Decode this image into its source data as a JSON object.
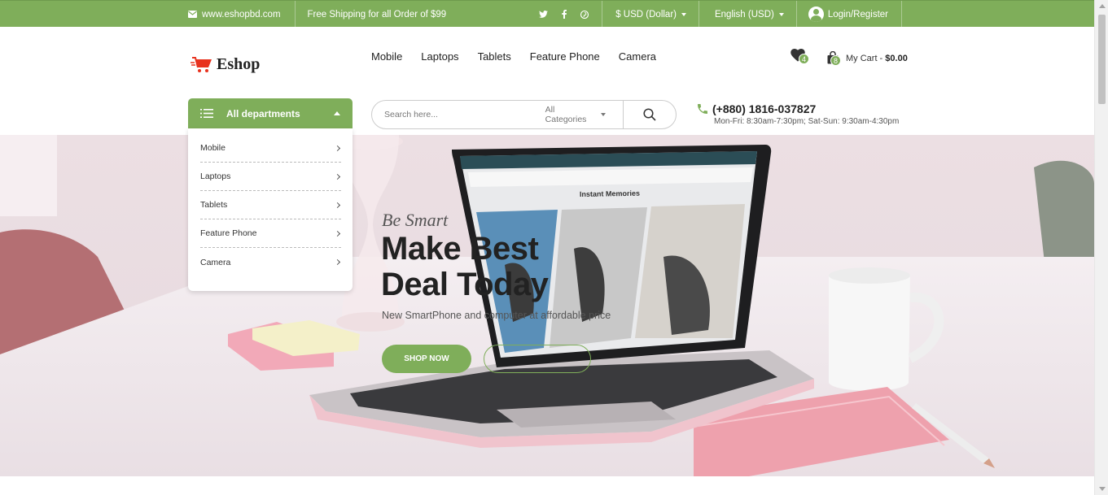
{
  "topbar": {
    "email": "www.eshopbd.com",
    "shipping": "Free Shipping for all Order of $99",
    "social": [
      "twitter-icon",
      "facebook-icon",
      "pinterest-icon"
    ],
    "currency": "$ USD (Dollar)",
    "language": "English (USD)",
    "login": "Login/Register"
  },
  "header": {
    "logo": "Eshop",
    "nav": [
      "Mobile",
      "Laptops",
      "Tablets",
      "Feature Phone",
      "Camera"
    ],
    "wishlist_count": "4",
    "cart_count": "8",
    "cart_label": "My Cart - ",
    "cart_amount": "$0.00"
  },
  "departments": {
    "title": "All departments",
    "items": [
      "Mobile",
      "Laptops",
      "Tablets",
      "Feature Phone",
      "Camera"
    ]
  },
  "search": {
    "placeholder": "Search here...",
    "category": "All Categories"
  },
  "contact": {
    "phone": "(+880) 1816-037827",
    "hours": "Mon-Fri: 8:30am-7:30pm; Sat-Sun: 9:30am-4:30pm"
  },
  "hero": {
    "kicker": "Be Smart",
    "title": "Make Best Deal Today",
    "subtitle": "New SmartPhone and computer at affordable price",
    "primary_button": "SHOP NOW",
    "laptop_screen_title": "Instant Memories"
  },
  "colors": {
    "accent": "#7fae5a",
    "text": "#222222"
  }
}
